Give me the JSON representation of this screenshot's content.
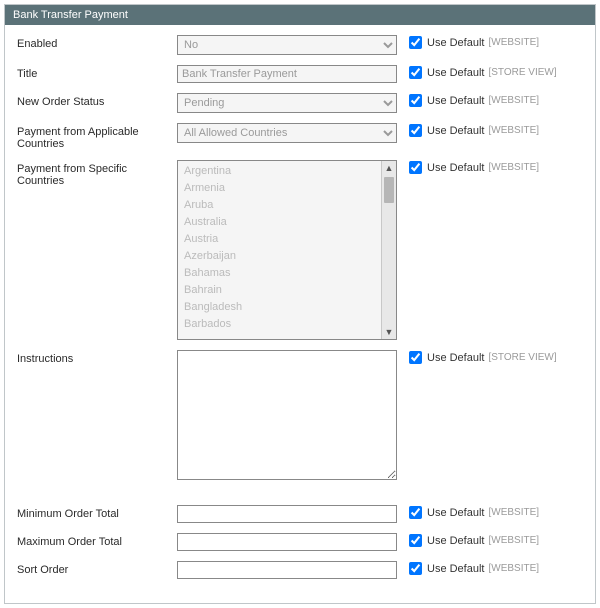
{
  "panel": {
    "title": "Bank Transfer Payment"
  },
  "common": {
    "use_default_label": "Use Default",
    "scope_website": "[WEBSITE]",
    "scope_storeview": "[STORE VIEW]"
  },
  "fields": {
    "enabled": {
      "label": "Enabled",
      "value": "No",
      "scope": "website",
      "checked": true
    },
    "title": {
      "label": "Title",
      "value": "Bank Transfer Payment",
      "scope": "storeview",
      "checked": true
    },
    "new_order_status": {
      "label": "New Order Status",
      "value": "Pending",
      "scope": "website",
      "checked": true
    },
    "applicable_countries": {
      "label": "Payment from Applicable Countries",
      "value": "All Allowed Countries",
      "scope": "website",
      "checked": true
    },
    "specific_countries": {
      "label": "Payment from Specific Countries",
      "scope": "website",
      "checked": true,
      "options": [
        "Argentina",
        "Armenia",
        "Aruba",
        "Australia",
        "Austria",
        "Azerbaijan",
        "Bahamas",
        "Bahrain",
        "Bangladesh",
        "Barbados"
      ]
    },
    "instructions": {
      "label": "Instructions",
      "value": "",
      "scope": "storeview",
      "checked": true
    },
    "min_order_total": {
      "label": "Minimum Order Total",
      "value": "",
      "scope": "website",
      "checked": true
    },
    "max_order_total": {
      "label": "Maximum Order Total",
      "value": "",
      "scope": "website",
      "checked": true
    },
    "sort_order": {
      "label": "Sort Order",
      "value": "",
      "scope": "website",
      "checked": true
    }
  }
}
